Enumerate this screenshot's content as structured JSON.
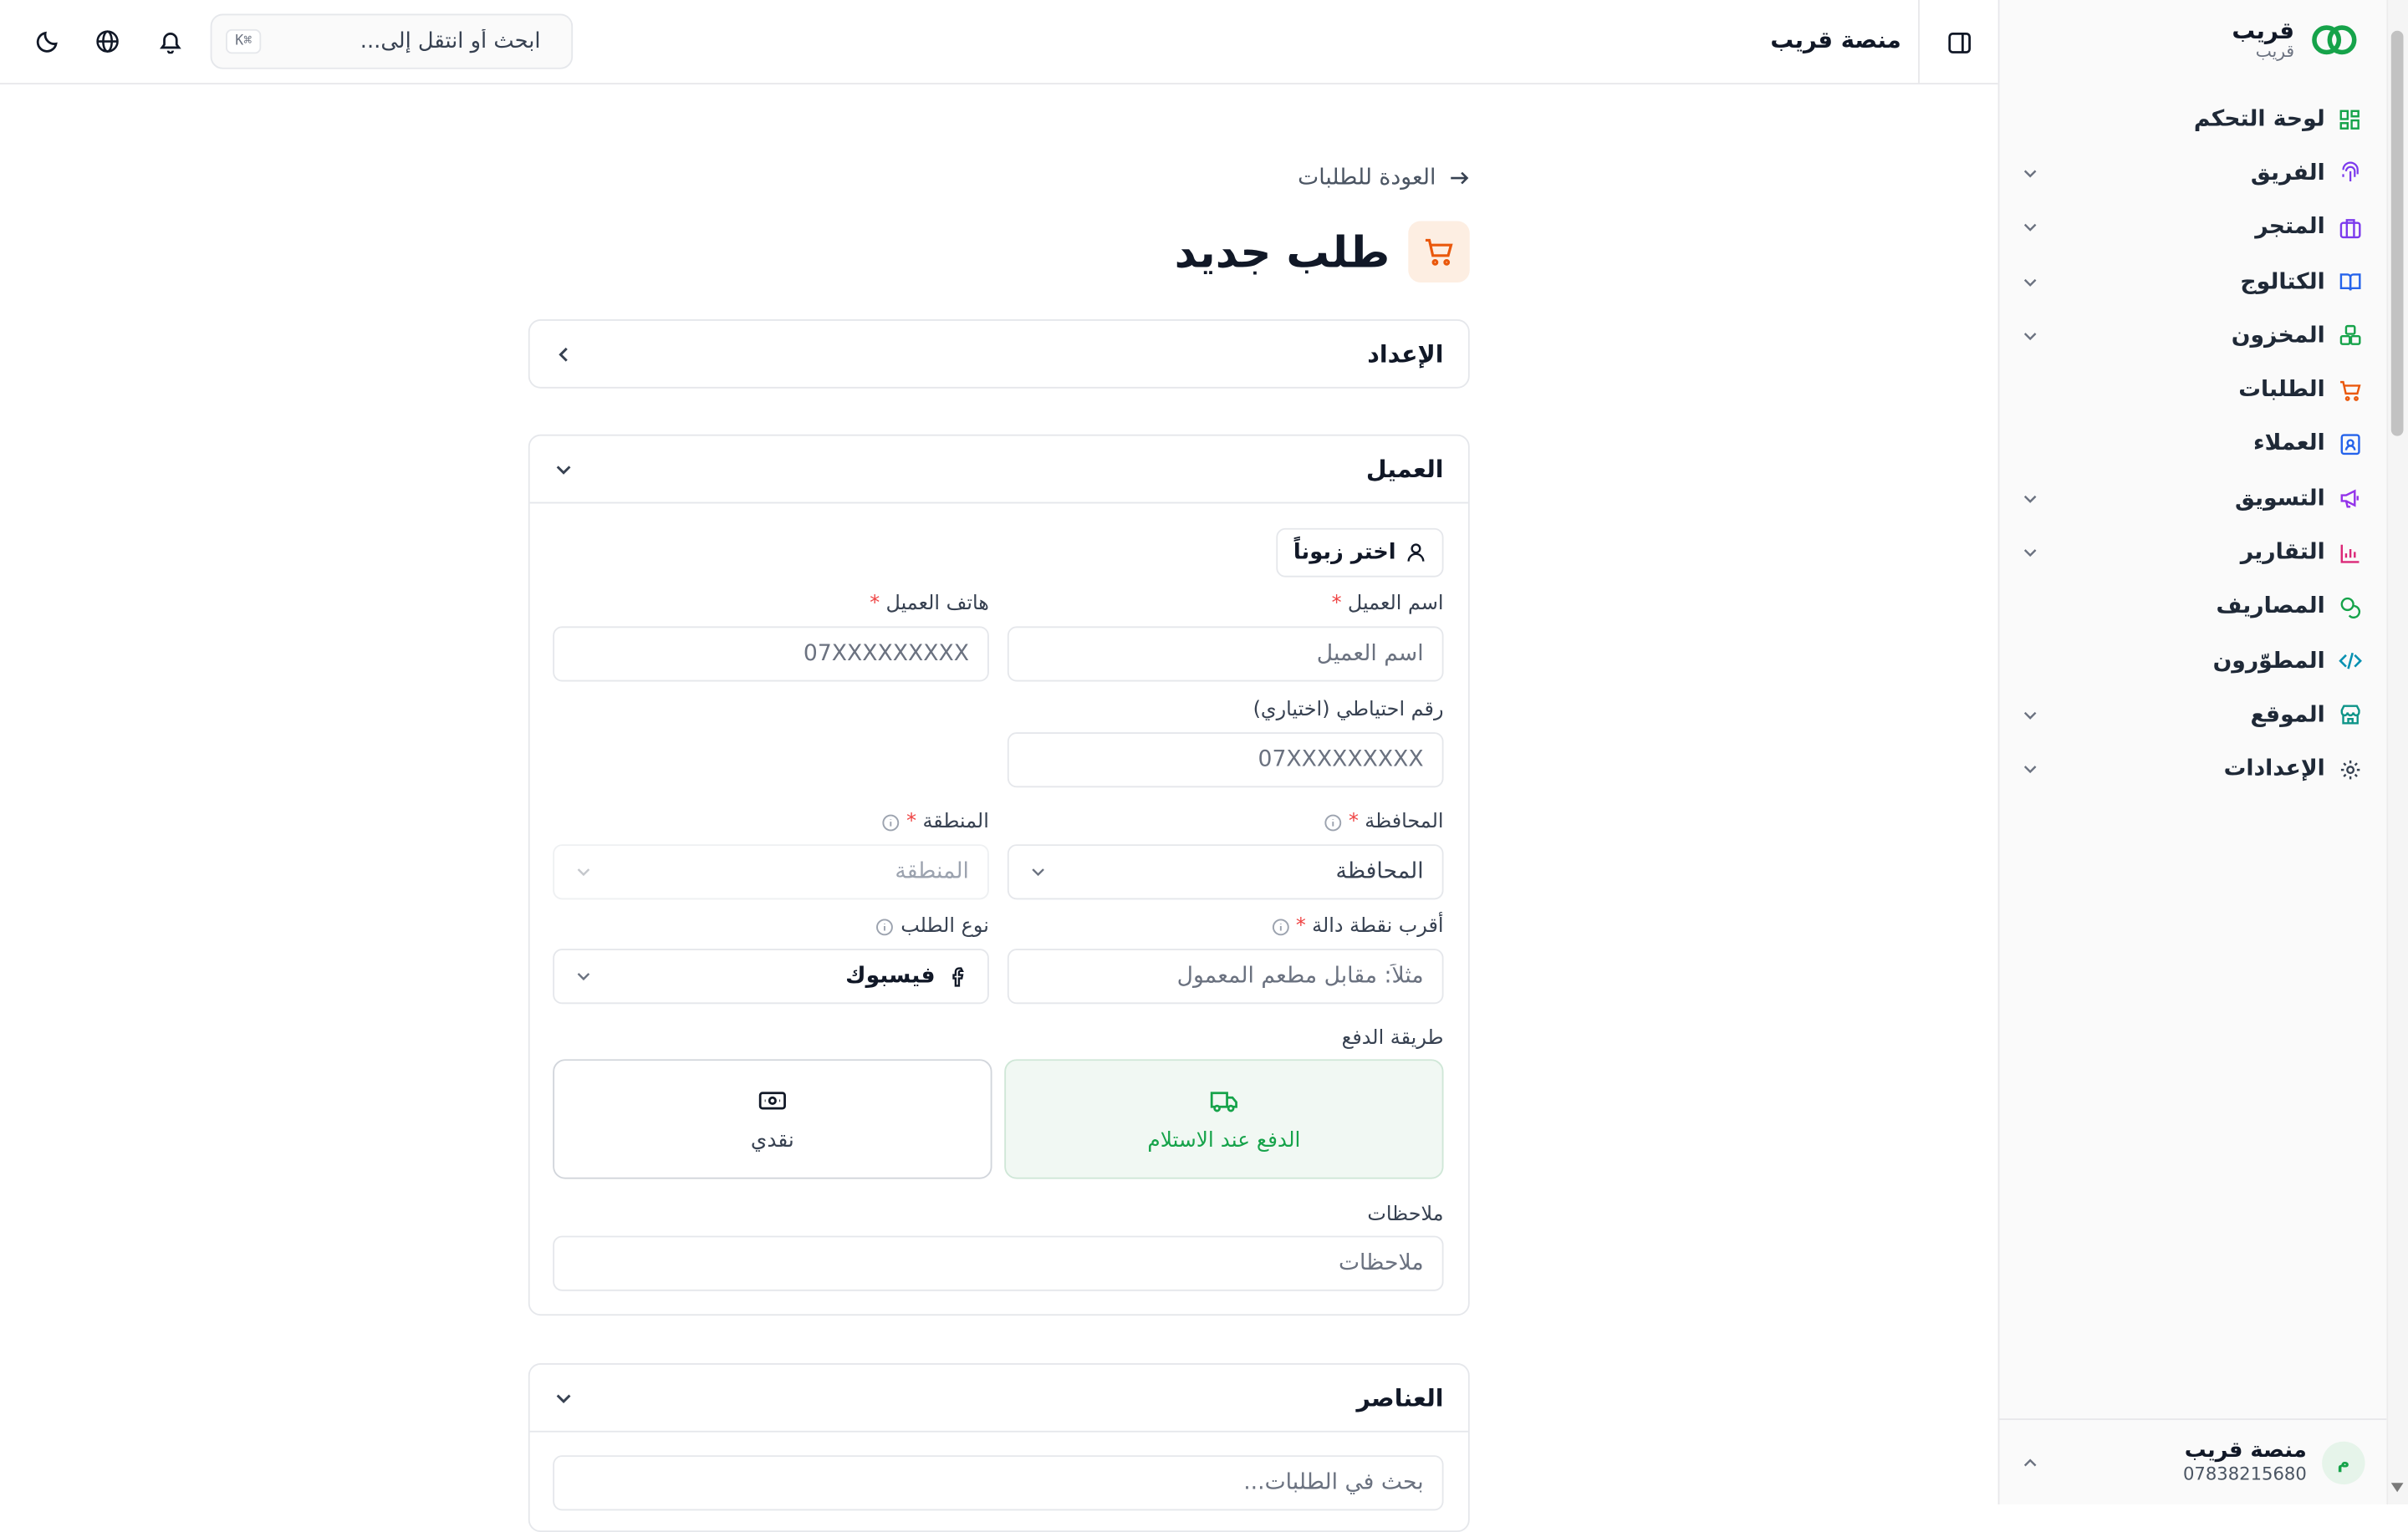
{
  "brand": {
    "name": "قريب",
    "sub": "قريب",
    "logo_color": "#16a34a"
  },
  "topbar": {
    "title": "منصة قريب",
    "search_placeholder": "ابحث أو انتقل إلى...",
    "shortcut": "⌘K"
  },
  "sidebar": {
    "items": [
      {
        "label": "لوحة التحكم",
        "icon": "dashboard-icon",
        "color": "#16a34a",
        "expandable": false
      },
      {
        "label": "الفريق",
        "icon": "fingerprint-icon",
        "color": "#7c3aed",
        "expandable": true
      },
      {
        "label": "المتجر",
        "icon": "briefcase-icon",
        "color": "#7c3aed",
        "expandable": true
      },
      {
        "label": "الكتالوج",
        "icon": "book-icon",
        "color": "#2563eb",
        "expandable": true
      },
      {
        "label": "المخزون",
        "icon": "boxes-icon",
        "color": "#16a34a",
        "expandable": true
      },
      {
        "label": "الطلبات",
        "icon": "cart-icon",
        "color": "#ea580c",
        "expandable": false
      },
      {
        "label": "العملاء",
        "icon": "contact-icon",
        "color": "#2563eb",
        "expandable": false
      },
      {
        "label": "التسويق",
        "icon": "megaphone-icon",
        "color": "#9333ea",
        "expandable": true
      },
      {
        "label": "التقارير",
        "icon": "bar-chart-icon",
        "color": "#db2777",
        "expandable": true
      },
      {
        "label": "المصاريف",
        "icon": "coins-icon",
        "color": "#16a34a",
        "expandable": false
      },
      {
        "label": "المطوّرون",
        "icon": "code-icon",
        "color": "#0891b2",
        "expandable": false
      },
      {
        "label": "الموقع",
        "icon": "store-icon",
        "color": "#0d9488",
        "expandable": true
      },
      {
        "label": "الإعدادات",
        "icon": "gear-icon",
        "color": "#374151",
        "expandable": true
      }
    ]
  },
  "user": {
    "initial": "م",
    "name": "منصة قريب",
    "phone": "07838215680"
  },
  "page": {
    "back_label": "العودة للطلبات",
    "title": "طلب جديد"
  },
  "setup_card": {
    "title": "الإعداد"
  },
  "customer_card": {
    "title": "العميل",
    "pick_button": "اختر زبوناً",
    "name_label": "اسم العميل",
    "name_placeholder": "اسم العميل",
    "phone_label": "هاتف العميل",
    "phone_placeholder": "07XXXXXXXXX",
    "backup_label": "رقم احتياطي (اختياري)",
    "backup_placeholder": "07XXXXXXXXX",
    "governorate_label": "المحافظة",
    "governorate_value": "المحافظة",
    "region_label": "المنطقة",
    "region_value": "المنطقة",
    "landmark_label": "أقرب نقطة دالة",
    "landmark_placeholder": "مثلاً: مقابل مطعم المعمول",
    "order_type_label": "نوع الطلب",
    "order_type_value": "فيسبوك",
    "payment_label": "طريقة الدفع",
    "payment_options": [
      "الدفع عند الاستلام",
      "نقدي"
    ],
    "notes_label": "ملاحظات",
    "notes_placeholder": "ملاحظات"
  },
  "items_card": {
    "title": "العناصر",
    "search_placeholder": "بحث في الطلبات..."
  }
}
